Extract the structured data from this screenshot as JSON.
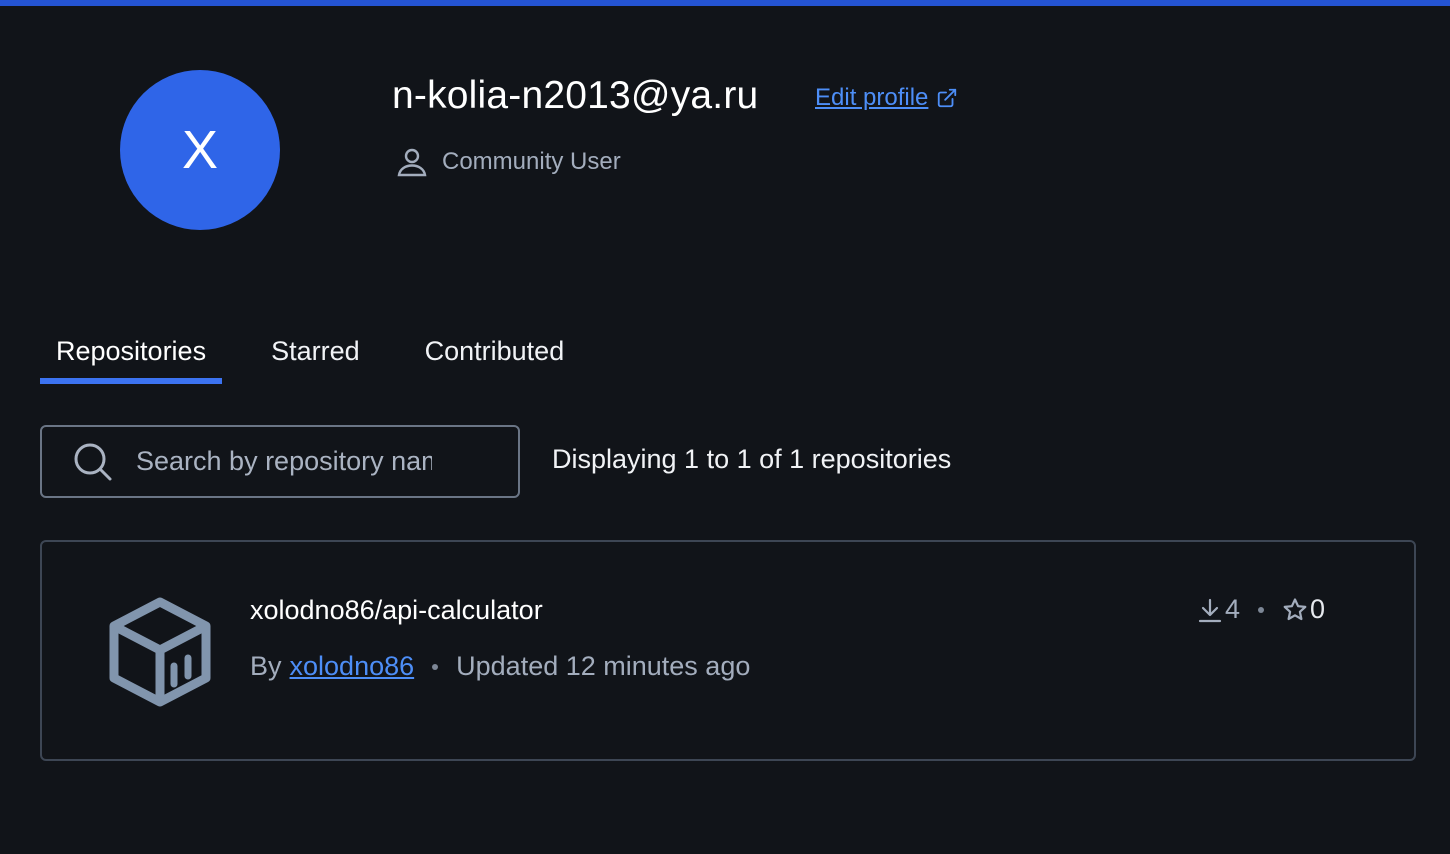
{
  "profile": {
    "avatar_initial": "X",
    "username": "n-kolia-n2013@ya.ru",
    "edit_profile_label": "Edit profile",
    "role": "Community User"
  },
  "tabs": [
    {
      "label": "Repositories",
      "active": true
    },
    {
      "label": "Starred",
      "active": false
    },
    {
      "label": "Contributed",
      "active": false
    }
  ],
  "search": {
    "placeholder": "Search by repository name",
    "value": ""
  },
  "results_summary": "Displaying 1 to 1 of 1 repositories",
  "repositories": [
    {
      "name": "xolodno86/api-calculator",
      "by_label": "By",
      "author": "xolodno86",
      "updated": "Updated 12 minutes ago",
      "downloads": "4",
      "stars": "0"
    }
  ],
  "colors": {
    "accent": "#2f65e8",
    "link": "#4d8ef7",
    "background": "#111419"
  },
  "icons": [
    "external-link-icon",
    "user-icon",
    "search-icon",
    "repository-cube-icon",
    "download-icon",
    "star-icon"
  ]
}
